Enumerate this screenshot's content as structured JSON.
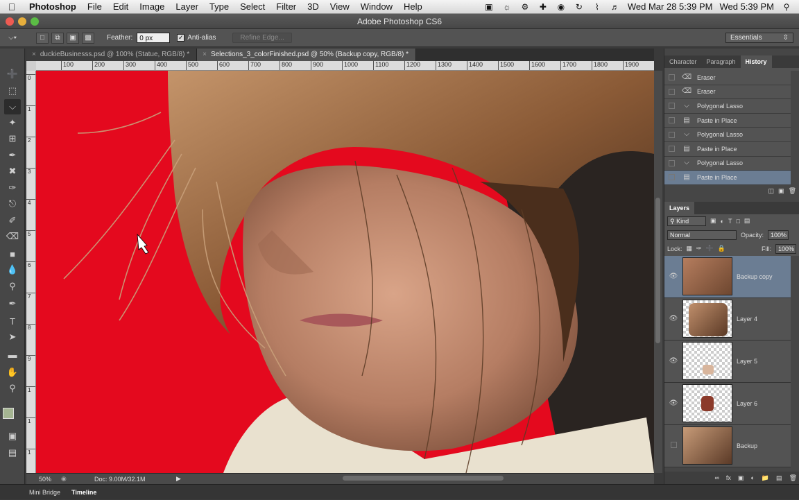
{
  "menubar": {
    "app_name": "Photoshop",
    "items": [
      "File",
      "Edit",
      "Image",
      "Layer",
      "Type",
      "Select",
      "Filter",
      "3D",
      "View",
      "Window",
      "Help"
    ],
    "clock1": "Wed Mar 28  5:39 PM",
    "clock2": "Wed 5:39 PM"
  },
  "window": {
    "title": "Adobe Photoshop CS6"
  },
  "options": {
    "feather_label": "Feather:",
    "feather_value": "0 px",
    "antialias_label": "Anti-alias",
    "refine_edge": "Refine Edge...",
    "workspace": "Essentials"
  },
  "tabs": [
    {
      "label": "duckieBusinesss.psd @ 100% (Statue, RGB/8) *"
    },
    {
      "label": "Selections_3_colorFinished.psd @ 50% (Backup copy, RGB/8) *"
    }
  ],
  "ruler": {
    "h": [
      "100",
      "200",
      "300",
      "400",
      "500",
      "600",
      "700",
      "800",
      "900",
      "1000",
      "1100",
      "1200",
      "1300",
      "1400",
      "1500",
      "1600",
      "1700",
      "1800",
      "1900",
      "2"
    ],
    "v": [
      "0",
      "1",
      "2",
      "3",
      "4",
      "5",
      "6",
      "7",
      "8",
      "9",
      "1",
      "1",
      "1"
    ]
  },
  "status": {
    "zoom": "50%",
    "doc": "Doc: 9.00M/32.1M"
  },
  "bottom": {
    "tabs": [
      "Mini Bridge",
      "Timeline"
    ]
  },
  "panels": {
    "top_tabs": [
      "Character",
      "Paragraph",
      "History"
    ],
    "history": [
      {
        "label": "Eraser",
        "icon": "eraser-icon"
      },
      {
        "label": "Eraser",
        "icon": "eraser-icon"
      },
      {
        "label": "Polygonal Lasso",
        "icon": "polygonal-lasso-icon"
      },
      {
        "label": "Paste in Place",
        "icon": "document-icon"
      },
      {
        "label": "Polygonal Lasso",
        "icon": "polygonal-lasso-icon"
      },
      {
        "label": "Paste in Place",
        "icon": "document-icon"
      },
      {
        "label": "Polygonal Lasso",
        "icon": "polygonal-lasso-icon"
      },
      {
        "label": "Paste in Place",
        "icon": "document-icon"
      }
    ],
    "layers_tab": "Layers",
    "kind": "Kind",
    "blend": "Normal",
    "opacity_label": "Opacity:",
    "opacity": "100%",
    "lock_label": "Lock:",
    "fill_label": "Fill:",
    "fill": "100%",
    "layers": [
      {
        "name": "Backup copy",
        "visible": true
      },
      {
        "name": "Layer 4",
        "visible": true
      },
      {
        "name": "Layer 5",
        "visible": true
      },
      {
        "name": "Layer 6",
        "visible": true
      },
      {
        "name": "Backup",
        "visible": false
      }
    ]
  },
  "colors": {
    "canvas_bg": "#e4091e",
    "selection": "#6b7d93"
  }
}
